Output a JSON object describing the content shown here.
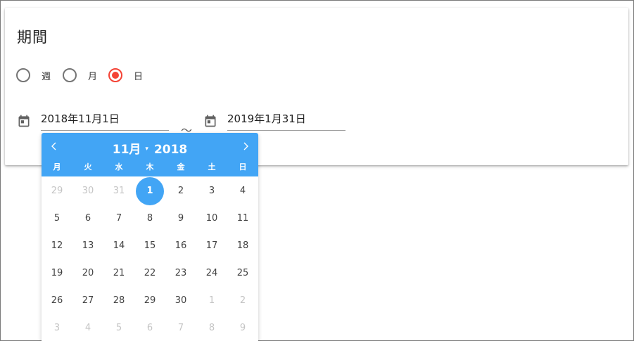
{
  "card": {
    "title": "期間",
    "radios": [
      {
        "label": "週",
        "checked": false
      },
      {
        "label": "月",
        "checked": false
      },
      {
        "label": "日",
        "checked": true
      }
    ],
    "start_date": "2018年11月1日",
    "separator": "～",
    "end_date": "2019年1月31日"
  },
  "picker": {
    "month": "11月",
    "caret": "▾",
    "year": "2018",
    "weekdays": [
      "月",
      "火",
      "水",
      "木",
      "金",
      "土",
      "日"
    ],
    "days": [
      {
        "d": "29",
        "muted": true
      },
      {
        "d": "30",
        "muted": true
      },
      {
        "d": "31",
        "muted": true
      },
      {
        "d": "1",
        "selected": true
      },
      {
        "d": "2"
      },
      {
        "d": "3"
      },
      {
        "d": "4"
      },
      {
        "d": "5"
      },
      {
        "d": "6"
      },
      {
        "d": "7"
      },
      {
        "d": "8"
      },
      {
        "d": "9"
      },
      {
        "d": "10"
      },
      {
        "d": "11"
      },
      {
        "d": "12"
      },
      {
        "d": "13"
      },
      {
        "d": "14"
      },
      {
        "d": "15"
      },
      {
        "d": "16"
      },
      {
        "d": "17"
      },
      {
        "d": "18"
      },
      {
        "d": "19"
      },
      {
        "d": "20"
      },
      {
        "d": "21"
      },
      {
        "d": "22"
      },
      {
        "d": "23"
      },
      {
        "d": "24"
      },
      {
        "d": "25"
      },
      {
        "d": "26"
      },
      {
        "d": "27"
      },
      {
        "d": "28"
      },
      {
        "d": "29"
      },
      {
        "d": "30"
      },
      {
        "d": "1",
        "muted": true
      },
      {
        "d": "2",
        "muted": true
      },
      {
        "d": "3",
        "muted": true
      },
      {
        "d": "4",
        "muted": true
      },
      {
        "d": "5",
        "muted": true
      },
      {
        "d": "6",
        "muted": true
      },
      {
        "d": "7",
        "muted": true
      },
      {
        "d": "8",
        "muted": true
      },
      {
        "d": "9",
        "muted": true
      }
    ]
  },
  "colors": {
    "accent": "#42a5f5",
    "radio_checked": "#f44336",
    "muted_text": "#c4c4c4"
  },
  "icons": [
    "calendar-icon",
    "chevron-left-icon",
    "chevron-right-icon"
  ]
}
